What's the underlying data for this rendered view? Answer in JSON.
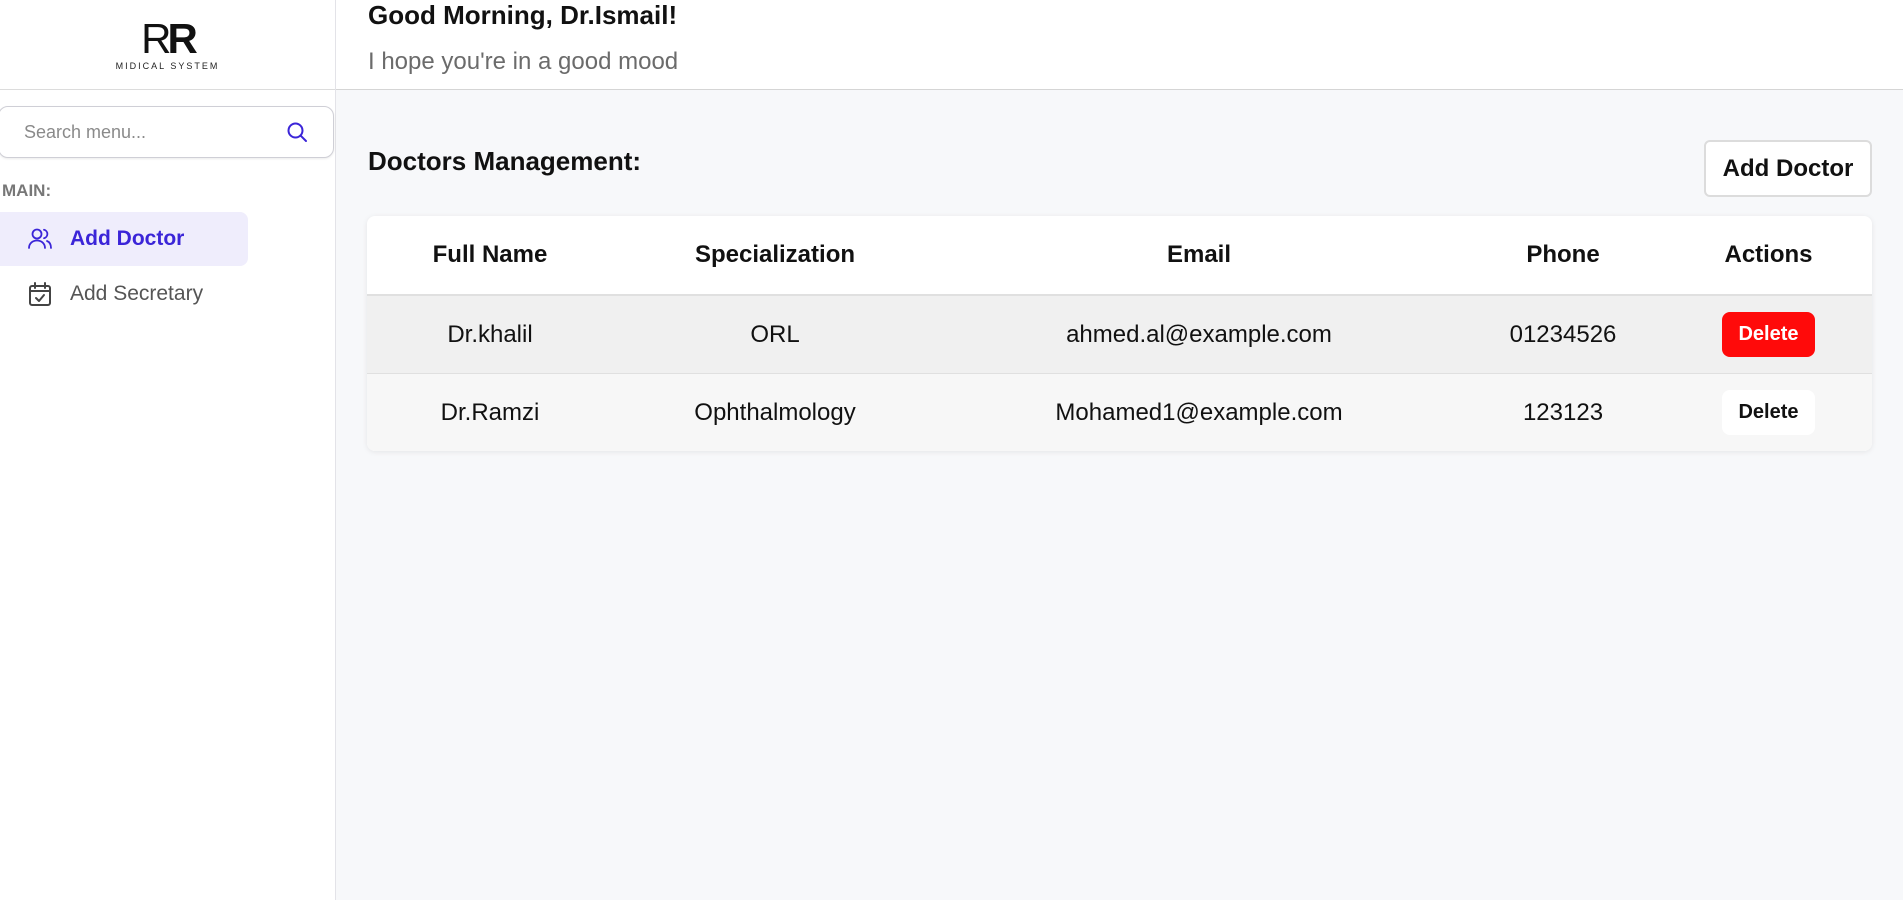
{
  "logo": {
    "mark_left": "R",
    "mark_right": "R",
    "subtitle": "MIDICAL SYSTEM"
  },
  "sidebar": {
    "search_placeholder": "Search menu...",
    "section_label": "MAIN:",
    "items": [
      {
        "label": "Add Doctor",
        "icon": "users-icon",
        "active": true
      },
      {
        "label": "Add Secretary",
        "icon": "calendar-check-icon",
        "active": false
      }
    ]
  },
  "header": {
    "greeting": "Good Morning, Dr.Ismail!",
    "subtitle": "I hope you're in a good mood"
  },
  "main": {
    "title": "Doctors Management:",
    "add_button": "Add Doctor",
    "table": {
      "headers": [
        "Full Name",
        "Specialization",
        "Email",
        "Phone",
        "Actions"
      ],
      "rows": [
        {
          "name": "Dr.khalil",
          "specialization": "ORL",
          "email": "ahmed.al@example.com",
          "phone": "01234526",
          "action": "Delete"
        },
        {
          "name": "Dr.Ramzi",
          "specialization": "Ophthalmology",
          "email": "Mohamed1@example.com",
          "phone": "123123",
          "action": "Delete"
        }
      ]
    }
  },
  "colors": {
    "accent": "#3b25d8",
    "active_bg": "#efedfc",
    "danger": "#ff0a0a"
  }
}
